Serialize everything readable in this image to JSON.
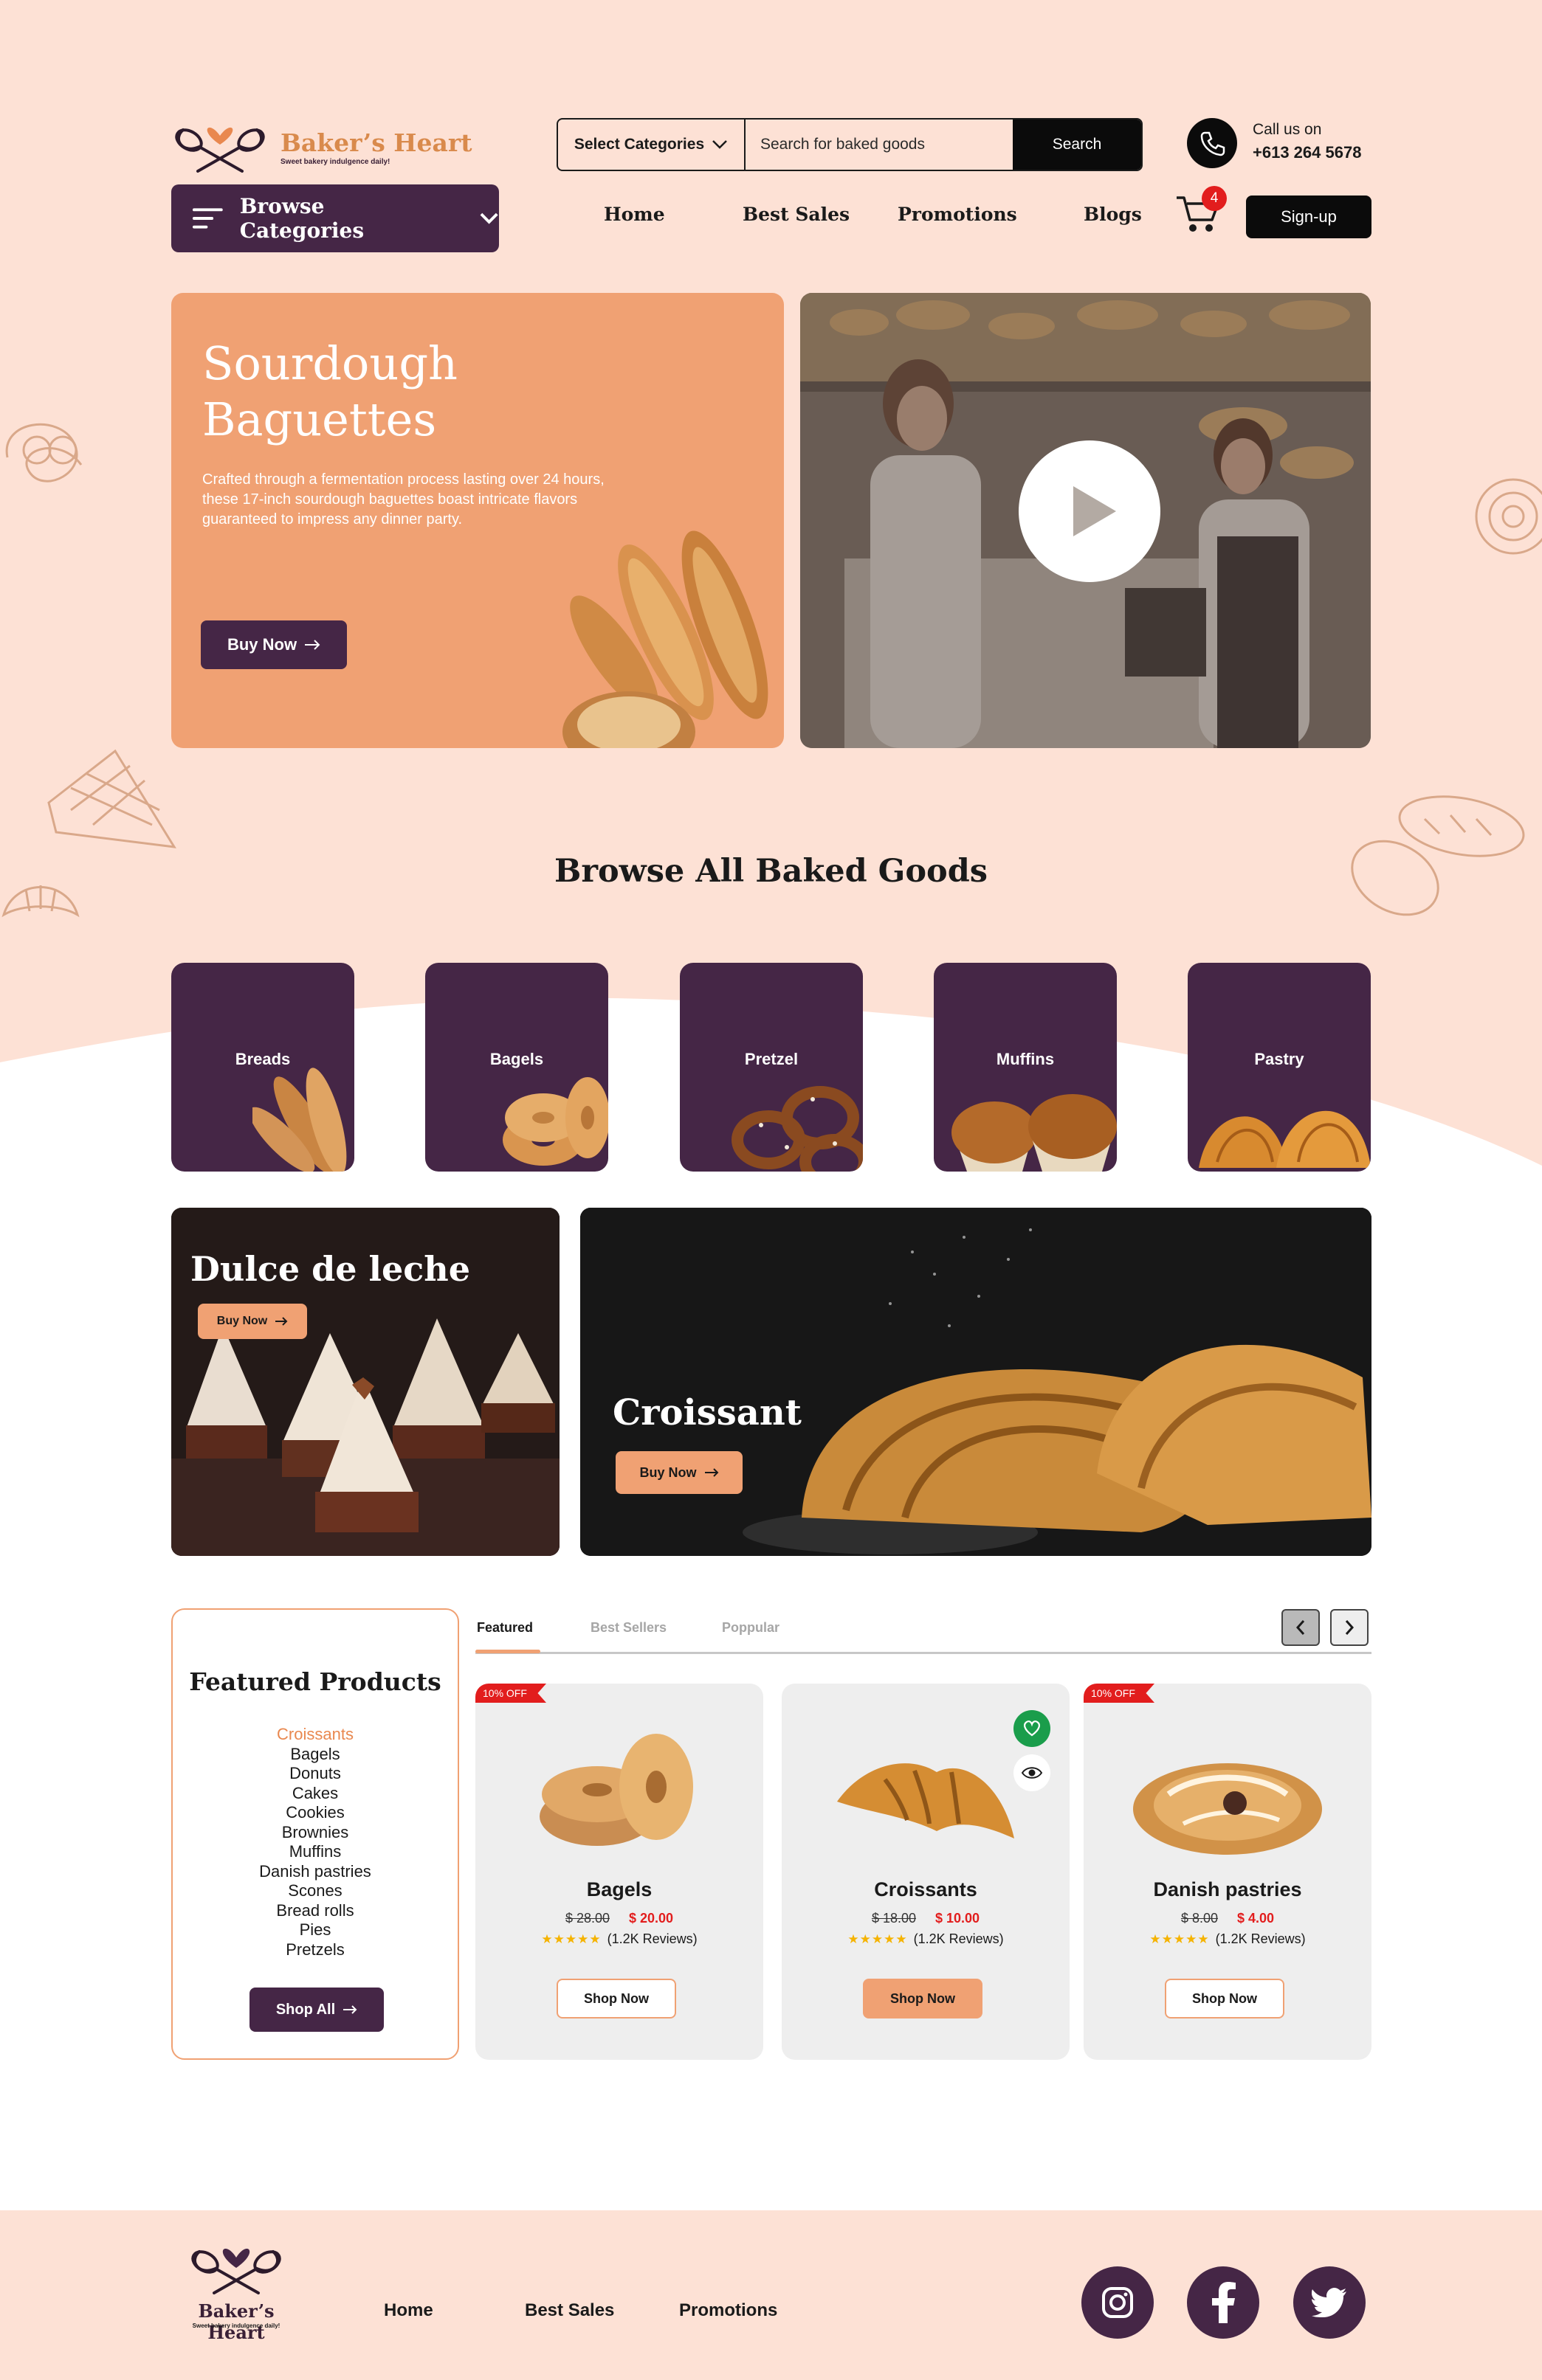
{
  "brand": {
    "name": "Baker’s Heart",
    "tagline": "Sweet bakery indulgence daily!"
  },
  "search": {
    "category_label": "Select Categories",
    "placeholder": "Search for baked goods",
    "button": "Search"
  },
  "contact": {
    "label": "Call us on",
    "phone": "+613 264 5678"
  },
  "nav": {
    "browse_label": "Browse Categories",
    "links": [
      "Home",
      "Best Sales",
      "Promotions",
      "Blogs"
    ],
    "cart_count": "4",
    "signup": "Sign-up"
  },
  "hero": {
    "title_line1": "Sourdough",
    "title_line2": "Baguettes",
    "description": "Crafted through a fermentation process lasting over 24 hours, these 17-inch sourdough baguettes boast intricate flavors guaranteed to impress any dinner party.",
    "buy_label": "Buy Now"
  },
  "browse": {
    "title": "Browse All Baked Goods",
    "categories": [
      "Breads",
      "Bagels",
      "Pretzel",
      "Muffins",
      "Pastry"
    ]
  },
  "promos": [
    {
      "title": "Dulce de leche",
      "buy_label": "Buy Now"
    },
    {
      "title": "Croissant",
      "buy_label": "Buy Now"
    }
  ],
  "featured": {
    "title": "Featured Products",
    "list": [
      "Croissants",
      "Bagels",
      "Donuts",
      "Cakes",
      "Cookies",
      "Brownies",
      "Muffins",
      "Danish pastries",
      "Scones",
      "Bread rolls",
      "Pies",
      "Pretzels"
    ],
    "active_item": "Croissants",
    "shop_all": "Shop All",
    "tabs": [
      "Featured",
      "Best Sellers",
      "Poppular"
    ],
    "active_tab": "Featured"
  },
  "products": [
    {
      "name": "Bagels",
      "old_price": "$ 28.00",
      "new_price": "$ 20.00",
      "reviews": "(1.2K Reviews)",
      "badge": "10% OFF",
      "cta": "Shop Now",
      "rating": 5
    },
    {
      "name": "Croissants",
      "old_price": "$ 18.00",
      "new_price": "$ 10.00",
      "reviews": "(1.2K Reviews)",
      "badge": "",
      "cta": "Shop Now",
      "rating": 5
    },
    {
      "name": "Danish pastries",
      "old_price": "$ 8.00",
      "new_price": "$ 4.00",
      "reviews": "(1.2K Reviews)",
      "badge": "10% OFF",
      "cta": "Shop Now",
      "rating": 5
    }
  ],
  "footer": {
    "links": [
      "Home",
      "Best Sales",
      "Promotions"
    ],
    "social": [
      "instagram-icon",
      "facebook-icon",
      "twitter-icon"
    ]
  },
  "colors": {
    "background": "#fde1d5",
    "primary": "#452646",
    "accent": "#f0a173",
    "brand_text": "#d98a4c",
    "sale_red": "#e21d1d"
  }
}
